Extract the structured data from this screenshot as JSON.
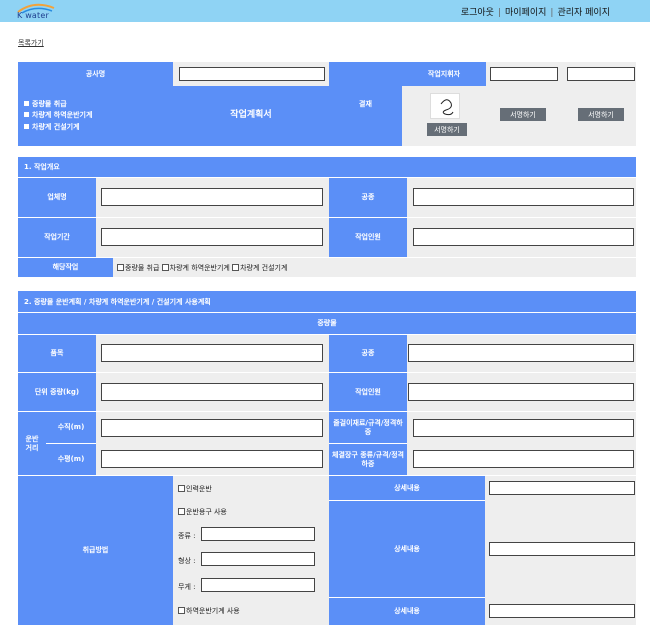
{
  "header": {
    "logo_text": "K water",
    "nav": [
      "로그아웃",
      "마이페이지",
      "관리자 페이지"
    ],
    "nav_separator": "|"
  },
  "back_link": "목록가기",
  "top_section": {
    "project_name_label": "공사명",
    "checklist": [
      "중량물 취급",
      "차량계 하역운반기계",
      "차량계 건설기계"
    ],
    "doc_title": "작업계획서",
    "approval_label": "결재",
    "supervisor_label": "작업지휘자",
    "sign_button": "서명하기",
    "sign_button_b": "서명하기",
    "sign_button_c": "서명하기"
  },
  "section1": {
    "title": "1. 작업개요",
    "company_label": "업체명",
    "trade_label": "공종",
    "period_label": "작업기간",
    "workers_label": "작업인원",
    "task_label": "해당작업",
    "task_options": [
      "중량물 취급",
      "차량계 하역운반기계",
      "차량계 건설기계"
    ]
  },
  "section2": {
    "title": "2. 중량물 운반계획 / 차량계 하역운반기계 / 건설기계 사용계획",
    "subtitle": "중량물",
    "item_label": "품목",
    "trade_label": "공종",
    "unit_weight_label": "단위 중량(kg)",
    "workers_label": "작업인원",
    "distance_label": "운반\n거리",
    "vertical_label": "수직(m)",
    "horizontal_label": "수평(m)",
    "lifting_gear_label": "줄걸이재료/규격/정격하중",
    "fastening_label": "체결장구 종류/규격/정격하중",
    "method_label": "취급방법",
    "manual_label": "인력운반",
    "tool_label": "운반용구 사용",
    "kind_label": "종류 :",
    "shape_label": "형상 :",
    "weight_label": "무게 :",
    "machine_label": "하역운반기계 사용",
    "detail_label": "상세내용",
    "detail_label_b": "상세내용",
    "detail_label_c": "상세내용"
  },
  "colors": {
    "topbar": "#8fd3f4",
    "header_blue": "#5b8ff7",
    "cell_gray": "#eeeeee",
    "button_gray": "#666e77"
  }
}
